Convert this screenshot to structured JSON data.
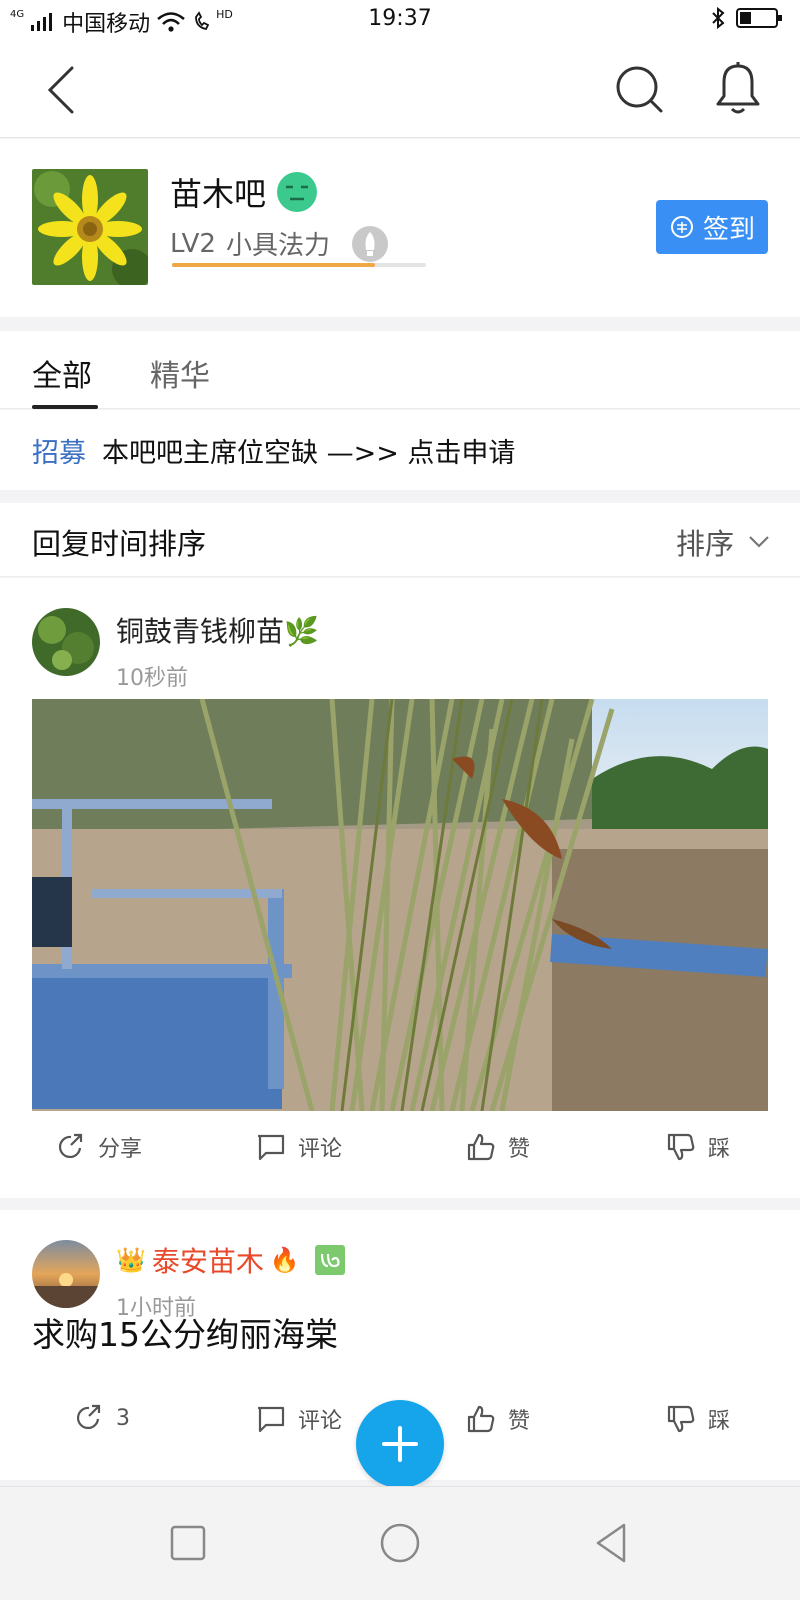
{
  "status_bar": {
    "carrier": "中国移动",
    "network": "4G",
    "time": "19:37",
    "hd": "HD"
  },
  "forum": {
    "name": "苗木吧",
    "level": "LV2",
    "level_title": "小具法力",
    "progress": 0.8,
    "sign_label": "签到"
  },
  "tabs": [
    {
      "label": "全部",
      "active": true
    },
    {
      "label": "精华",
      "active": false
    }
  ],
  "notice": {
    "tag": "招募",
    "text": "本吧吧主席位空缺 —>> 点击申请"
  },
  "sort": {
    "title": "回复时间排序",
    "button": "排序"
  },
  "posts": [
    {
      "author": "铜鼓青钱柳苗🌿",
      "time": "10秒前",
      "actions": {
        "share": "分享",
        "comment": "评论",
        "like": "赞",
        "dislike": "踩"
      }
    },
    {
      "author": "泰安苗木",
      "time": "1小时前",
      "text": "求购15公分绚丽海棠",
      "actions": {
        "share": "3",
        "comment": "评论",
        "like": "赞",
        "dislike": "踩"
      }
    }
  ],
  "colors": {
    "accent": "#3a8ff5",
    "fab": "#16a5ea",
    "progress": "#f0a844",
    "notice_tag": "#3a6fc4",
    "vip_name": "#e8492a"
  }
}
